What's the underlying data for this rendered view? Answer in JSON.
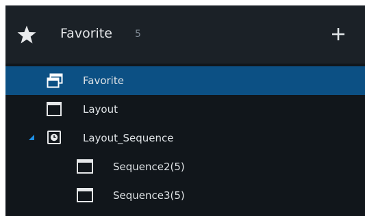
{
  "header": {
    "title": "Favorite",
    "count": "5",
    "star_icon": "star-icon",
    "add_icon": "plus-icon"
  },
  "tree": {
    "items": [
      {
        "label": "Favorite",
        "icon": "favorite-windows-icon",
        "selected": true
      },
      {
        "label": "Layout",
        "icon": "window-icon"
      },
      {
        "label": "Layout_Sequence",
        "icon": "sequence-icon",
        "expanded": true
      },
      {
        "label": "Sequence2(5)",
        "icon": "window-icon"
      },
      {
        "label": "Sequence3(5)",
        "icon": "window-icon"
      }
    ]
  },
  "colors": {
    "selected_bg": "#0c5084",
    "panel_bg": "#11161b",
    "header_bg": "#1b2127",
    "caret": "#1e8fe6",
    "text": "#dfe3e6",
    "count": "#7f8a94"
  }
}
